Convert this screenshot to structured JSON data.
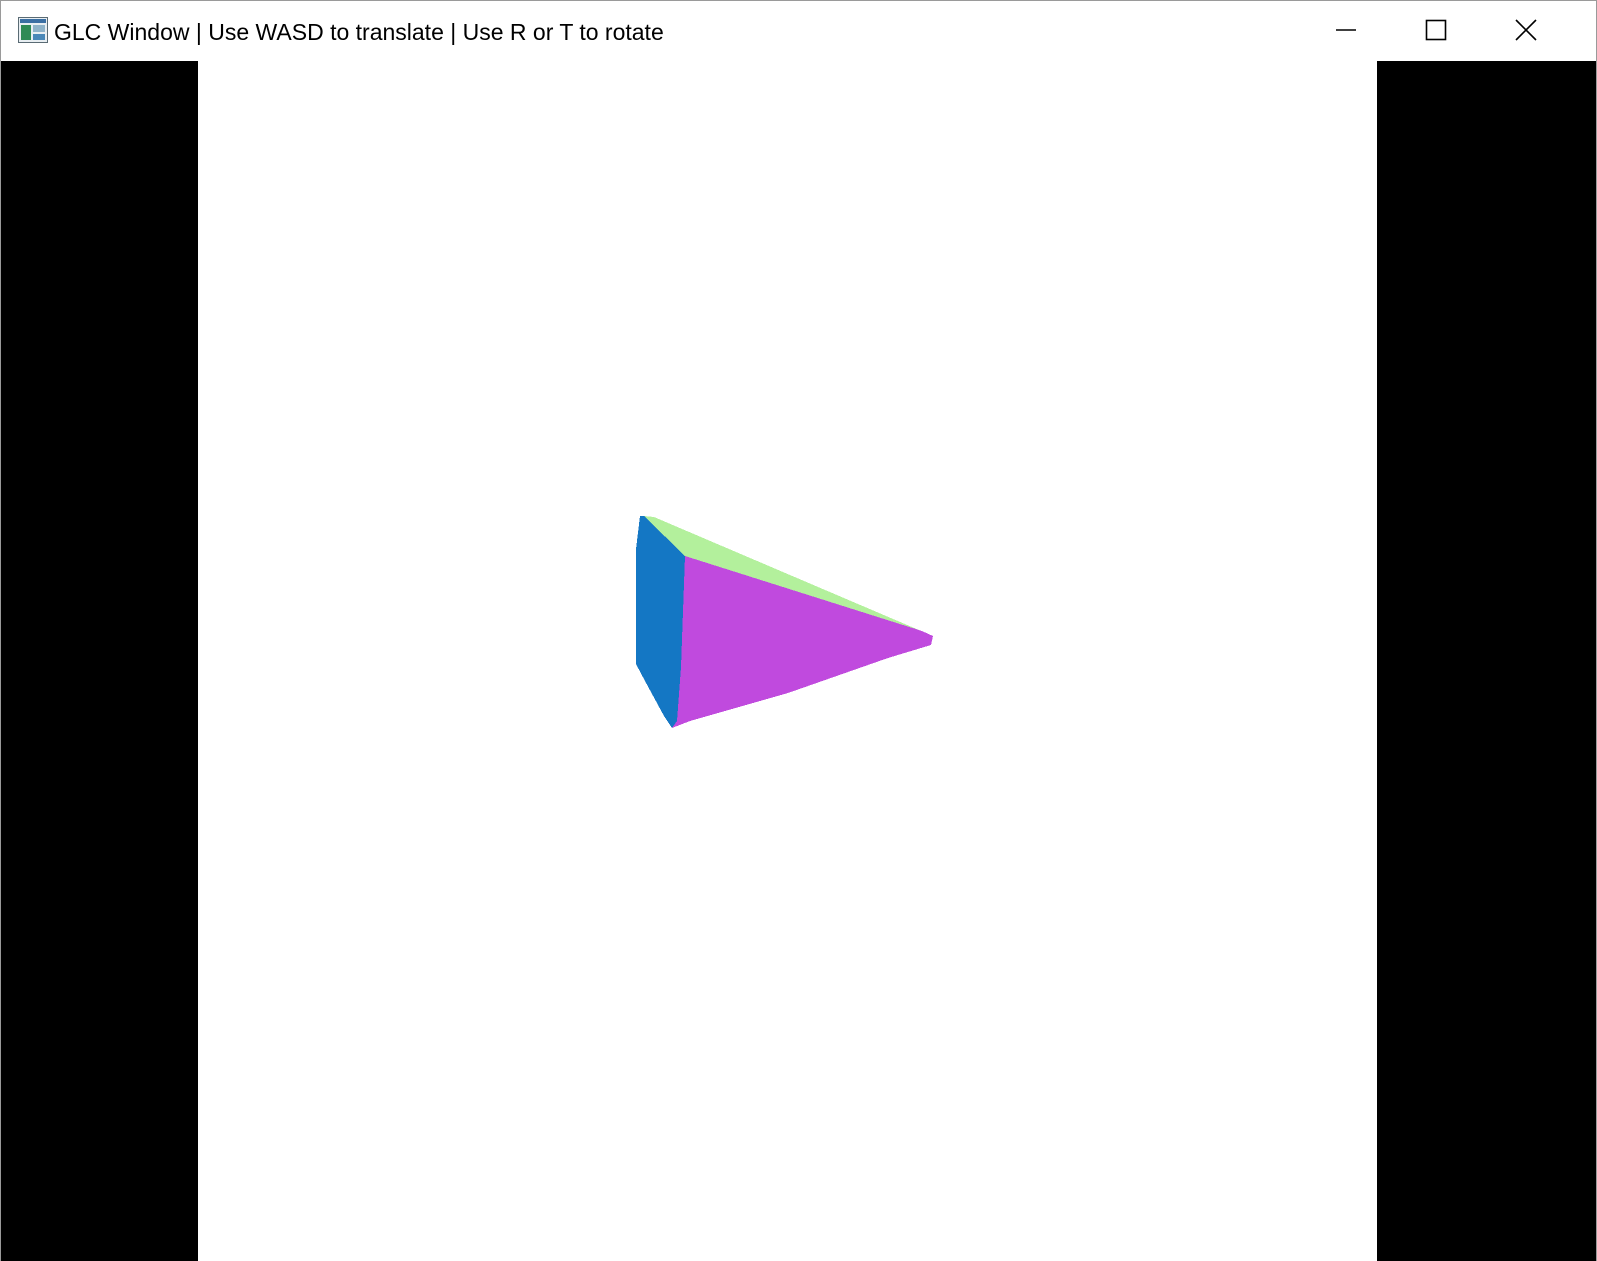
{
  "window": {
    "title": "GLC Window | Use WASD to translate | Use R or T to rotate",
    "icon": "app-window-icon",
    "controls": {
      "minimize_icon": "minimize-icon",
      "maximize_icon": "maximize-icon",
      "close_icon": "close-icon"
    }
  },
  "scene": {
    "object": "pyramid",
    "background_color": "#ffffff",
    "letterbox_color": "#000000",
    "faces": [
      {
        "name": "left-face",
        "color": "#1477c4"
      },
      {
        "name": "top-face",
        "color": "#b3f09c"
      },
      {
        "name": "front-face",
        "color": "#c04ade"
      }
    ]
  }
}
